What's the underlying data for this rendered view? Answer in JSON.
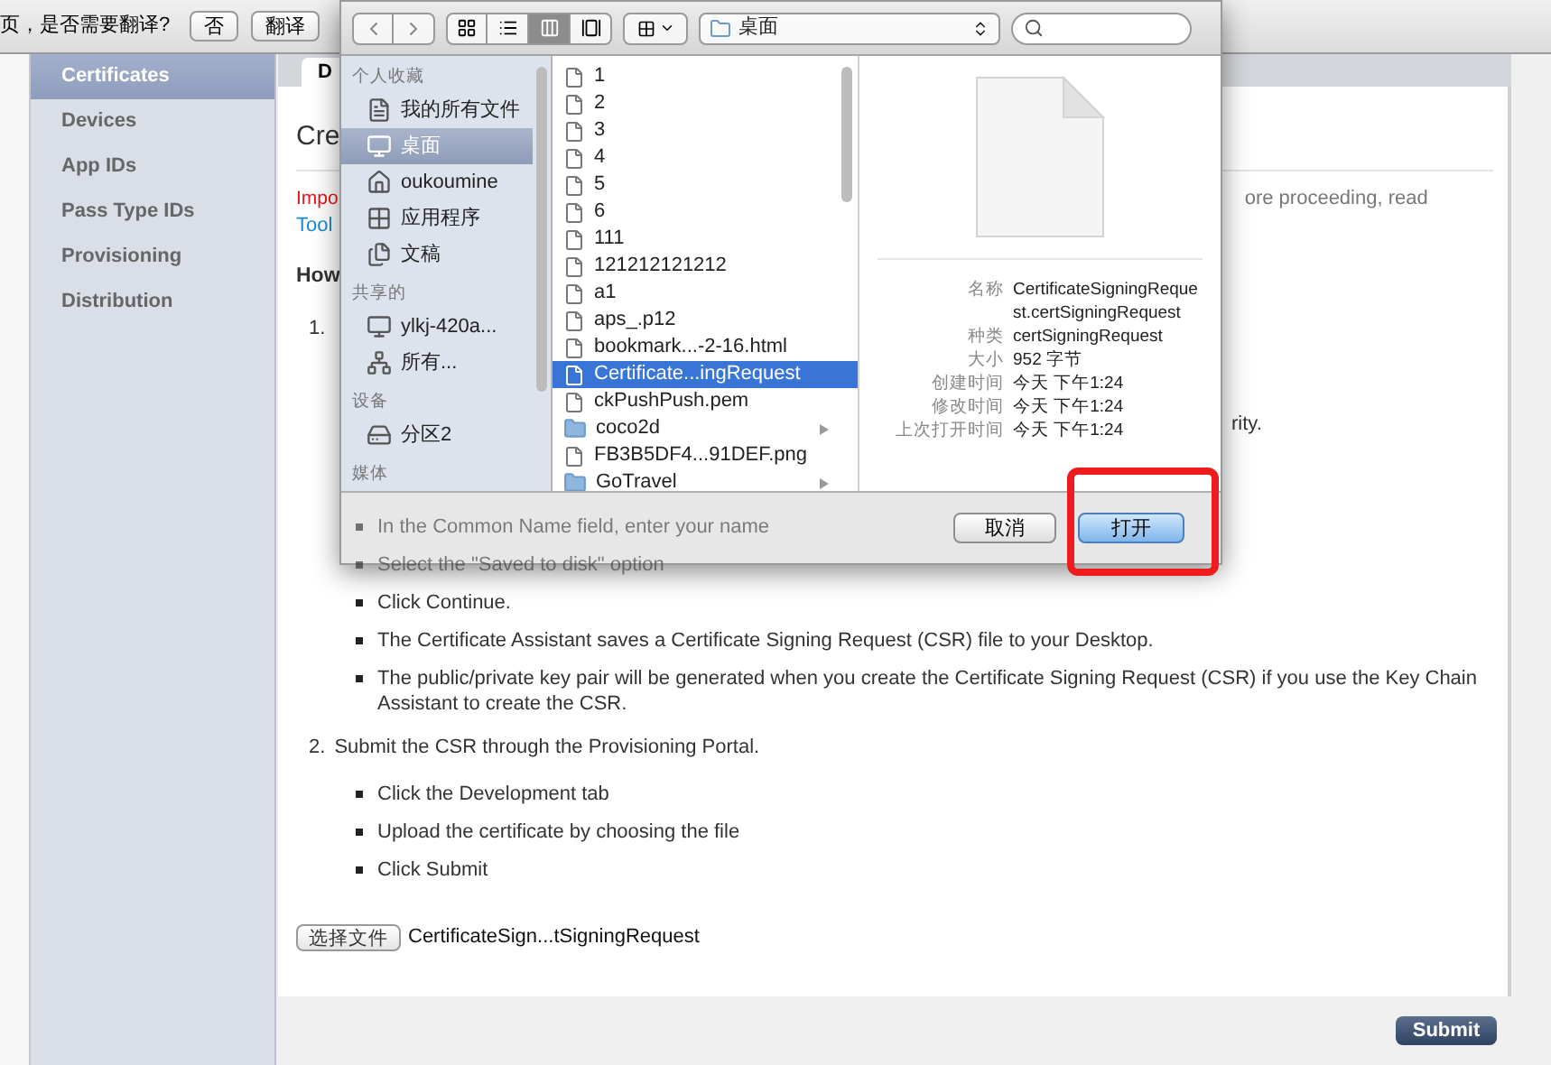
{
  "translate_bar": {
    "prompt": "页，是否需要翻译?",
    "buttons": [
      "否",
      "翻译"
    ]
  },
  "sidebar": {
    "items": [
      {
        "label": "Certificates",
        "selected": true
      },
      {
        "label": "Devices",
        "selected": false
      },
      {
        "label": "App IDs",
        "selected": false
      },
      {
        "label": "Pass Type IDs",
        "selected": false
      },
      {
        "label": "Provisioning",
        "selected": false
      },
      {
        "label": "Distribution",
        "selected": false
      }
    ]
  },
  "tabs": [
    {
      "label": "D",
      "selected": true
    }
  ],
  "content": {
    "title": "Cre",
    "important": "Impo",
    "important_tail": "ore proceeding, read",
    "link": "Tool",
    "heading": "How",
    "steps": [
      {
        "number": "1.",
        "tail": "rity.",
        "bullets": [
          "In the Common Name field, enter your name",
          "Select the \"Saved to disk\" option",
          "Click Continue.",
          "The Certificate Assistant saves a Certificate Signing Request (CSR) file to your Desktop.",
          "The public/private key pair will be generated when you create the Certificate Signing Request (CSR) if you use the Key Chain Assistant to create the CSR."
        ]
      },
      {
        "number": "2.",
        "text": "Submit the CSR through the Provisioning Portal.",
        "bullets": [
          "Click the Development tab",
          "Upload the certificate by choosing the file",
          "Click Submit"
        ]
      }
    ],
    "file_input": {
      "button": "选择文件",
      "value": "CertificateSign...tSigningRequest"
    }
  },
  "footer": {
    "submit": "Submit"
  },
  "dialog": {
    "location": "桌面",
    "sidebar": [
      {
        "heading": "个人收藏",
        "items": [
          {
            "label": "我的所有文件",
            "selected": false
          },
          {
            "label": "桌面",
            "selected": true
          },
          {
            "label": "oukoumine",
            "selected": false
          },
          {
            "label": "应用程序",
            "selected": false
          },
          {
            "label": "文稿",
            "selected": false
          }
        ]
      },
      {
        "heading": "共享的",
        "items": [
          {
            "label": "ylkj-420a...",
            "selected": false
          },
          {
            "label": "所有...",
            "selected": false
          }
        ]
      },
      {
        "heading": "设备",
        "items": [
          {
            "label": "分区2",
            "selected": false
          }
        ]
      },
      {
        "heading": "媒体"
      }
    ],
    "files": [
      {
        "name": "1",
        "kind": "file",
        "selected": false
      },
      {
        "name": "2",
        "kind": "file",
        "selected": false
      },
      {
        "name": "3",
        "kind": "file",
        "selected": false
      },
      {
        "name": "4",
        "kind": "file",
        "selected": false
      },
      {
        "name": "5",
        "kind": "file",
        "selected": false
      },
      {
        "name": "6",
        "kind": "file",
        "selected": false
      },
      {
        "name": "111",
        "kind": "file",
        "selected": false
      },
      {
        "name": "121212121212",
        "kind": "file",
        "selected": false
      },
      {
        "name": "a1",
        "kind": "file",
        "selected": false
      },
      {
        "name": "aps_.p12",
        "kind": "file",
        "selected": false
      },
      {
        "name": "bookmark...-2-16.html",
        "kind": "file",
        "selected": false
      },
      {
        "name": "Certificate...ingRequest",
        "kind": "file",
        "selected": true
      },
      {
        "name": "ckPushPush.pem",
        "kind": "file",
        "selected": false
      },
      {
        "name": "coco2d",
        "kind": "folder",
        "selected": false
      },
      {
        "name": "FB3B5DF4...91DEF.png",
        "kind": "file",
        "selected": false
      },
      {
        "name": "GoTravel",
        "kind": "folder",
        "selected": false
      }
    ],
    "info": [
      {
        "label": "名称",
        "value": "CertificateSigningRequest.certSigningRequest"
      },
      {
        "label": "种类",
        "value": "certSigningRequest"
      },
      {
        "label": "大小",
        "value": "952 字节"
      },
      {
        "label": "创建时间",
        "value": "今天 下午1:24"
      },
      {
        "label": "修改时间",
        "value": "今天 下午1:24"
      },
      {
        "label": "上次打开时间",
        "value": "今天 下午1:24"
      }
    ],
    "buttons": {
      "cancel": "取消",
      "open": "打开"
    }
  }
}
